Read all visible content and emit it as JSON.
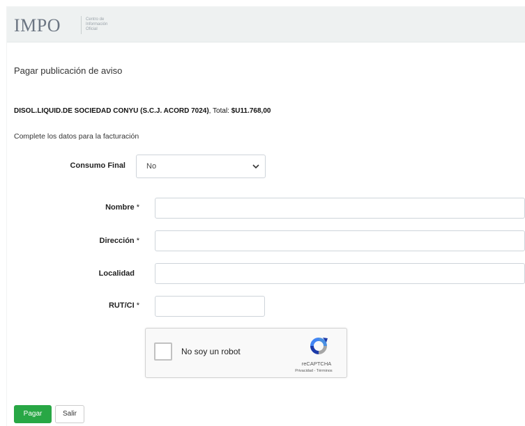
{
  "header": {
    "logo": "IMPO",
    "subtitle_lines": [
      "Centro de",
      "Información",
      "Oficial"
    ]
  },
  "page": {
    "title": "Pagar publicación de aviso",
    "summary_name": "DISOL.LIQUID.DE SOCIEDAD CONYU (S.C.J. ACORD 7024)",
    "summary_total_label": ", Total: ",
    "summary_total_value": "$U11.768,00",
    "instructions": "Complete los datos para la facturación"
  },
  "form": {
    "consumo_final_label": "Consumo Final",
    "consumo_final_value": "No",
    "nombre_label": "Nombre",
    "direccion_label": "Dirección",
    "localidad_label": "Localidad",
    "rutci_label": "RUT/CI",
    "required_mark": " *",
    "nombre_value": "",
    "direccion_value": "",
    "localidad_value": "",
    "rutci_value": ""
  },
  "captcha": {
    "text": "No soy un robot",
    "brand": "reCAPTCHA",
    "links": "Privacidad - Términos"
  },
  "buttons": {
    "pay": "Pagar",
    "exit": "Salir"
  },
  "colors": {
    "header_bg": "#eef1f1",
    "pay_button": "#28a745",
    "border": "#ced4da"
  },
  "icons": {
    "select": "chevron-down-icon",
    "captcha": "recaptcha-icon"
  }
}
